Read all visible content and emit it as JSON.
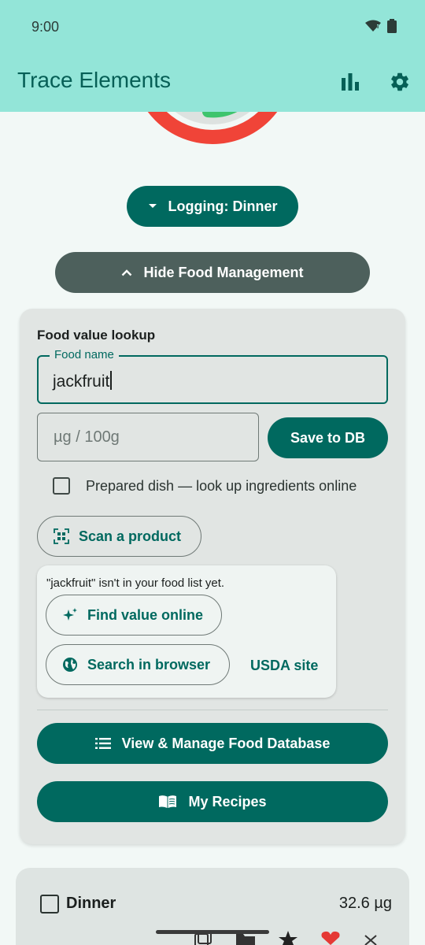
{
  "status_bar": {
    "time": "9:00"
  },
  "app_bar": {
    "title": "Trace Elements"
  },
  "logging_button": {
    "label": "Logging: Dinner"
  },
  "hide_button": {
    "label": "Hide Food Management"
  },
  "lookup_card": {
    "heading": "Food value lookup",
    "food_name_label": "Food name",
    "food_name_value": "jackfruit",
    "amount_placeholder": "µg / 100g",
    "save_label": "Save to DB",
    "prepared_dish_label": "Prepared dish — look up ingredients online",
    "scan_label": "Scan a product",
    "not_found_message": "\"jackfruit\" isn't in your food list yet.",
    "find_online_label": "Find value online",
    "search_browser_label": "Search in browser",
    "usda_link_label": "USDA site",
    "view_db_label": "View & Manage Food Database",
    "recipes_label": "My Recipes"
  },
  "meal_card": {
    "meal_name": "Dinner",
    "total": "32.6 µg"
  },
  "colors": {
    "primary": "#00695f",
    "app_bar": "#93e5d8",
    "gauge_red": "#f04438",
    "gauge_green": "#3ec46d"
  }
}
